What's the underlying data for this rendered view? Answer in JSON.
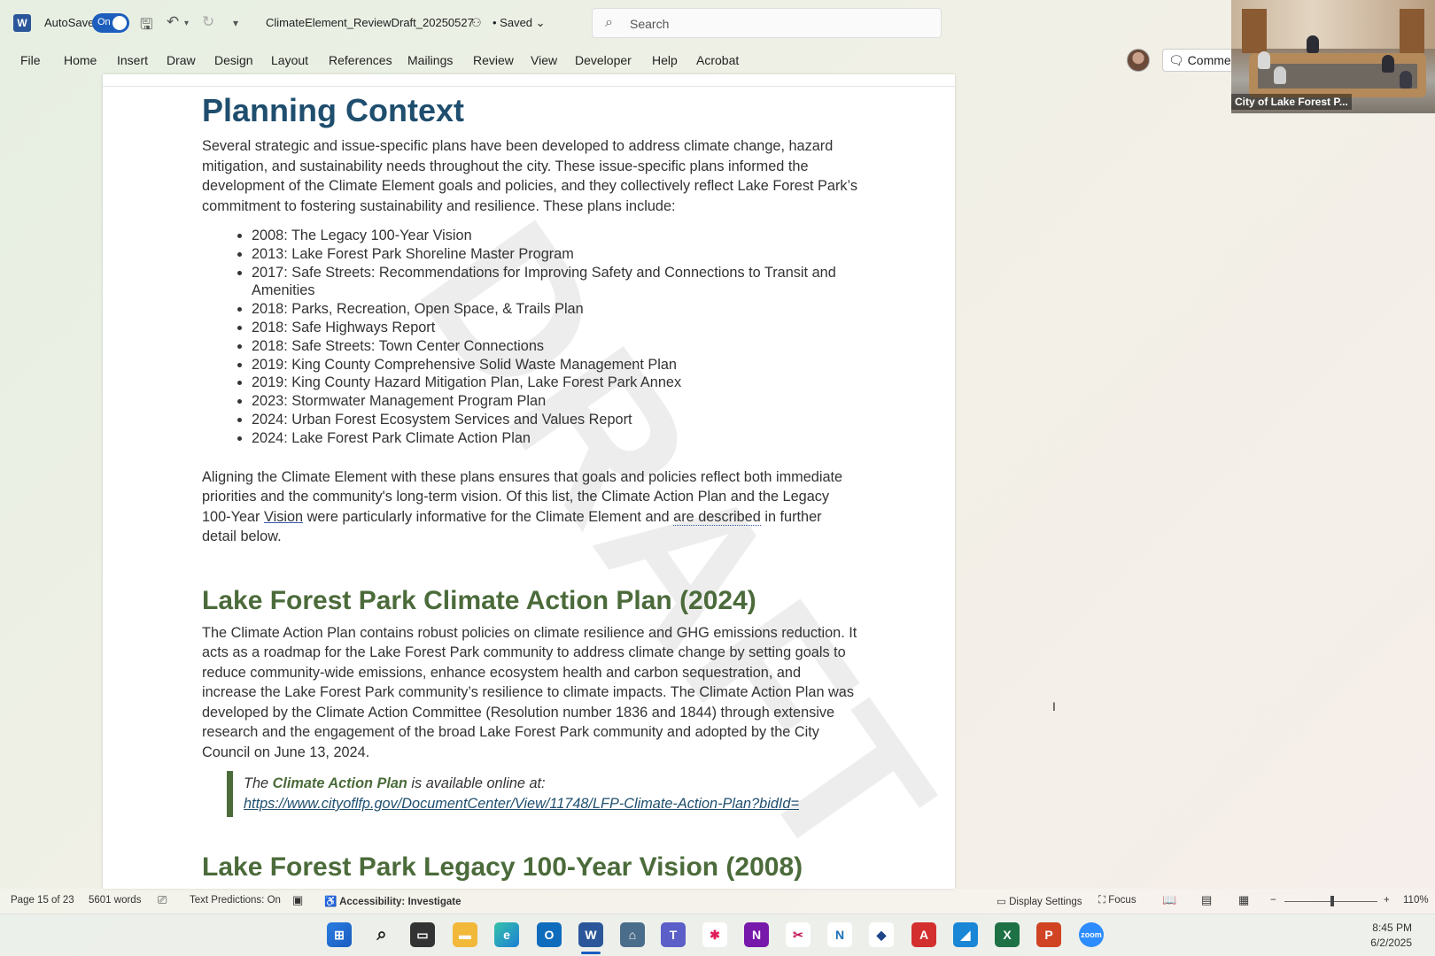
{
  "titlebar": {
    "app_icon": "W",
    "autosave_label": "AutoSave",
    "autosave_state": "On",
    "document_name": "ClimateElement_ReviewDraft_20250527",
    "saved_status": "• Saved",
    "search_placeholder": "Search"
  },
  "ribbon": {
    "tabs": [
      "File",
      "Home",
      "Insert",
      "Draw",
      "Design",
      "Layout",
      "References",
      "Mailings",
      "Review",
      "View",
      "Developer",
      "Help",
      "Acrobat"
    ],
    "comments_label": "Comments"
  },
  "video": {
    "participant_label": "City of Lake Forest P..."
  },
  "document": {
    "watermark": "DRAFT",
    "heading1": "Planning Context",
    "para1": "Several strategic and issue-specific plans have been developed to address climate change, hazard mitigation, and sustainability needs throughout the city. These issue-specific plans informed the development of the Climate Element goals and policies, and they collectively reflect Lake Forest Park’s commitment to fostering sustainability and resilience. These plans include:",
    "plans": [
      "2008: The Legacy 100-Year Vision",
      "2013: Lake Forest Park Shoreline Master Program",
      "2017: Safe Streets: Recommendations for Improving Safety and Connections to Transit and Amenities",
      "2018: Parks, Recreation, Open Space, & Trails Plan",
      "2018: Safe Highways Report",
      "2018: Safe Streets: Town Center Connections",
      "2019: King County Comprehensive Solid Waste Management Plan",
      "2019: King County Hazard Mitigation Plan, Lake Forest Park Annex",
      "2023: Stormwater Management Program Plan",
      "2024: Urban Forest Ecosystem Services and Values Report",
      "2024: Lake Forest Park Climate Action Plan"
    ],
    "para2_a": "Aligning the Climate Element with these plans ensures that goals and policies reflect both immediate priorities and the community's long-term vision. Of this list, the Climate Action Plan and the Legacy 100-Year ",
    "para2_vision": "Vision",
    "para2_b": " were particularly informative for the Climate Element and ",
    "para2_are": "are described",
    "para2_c": " in further detail below.",
    "heading2": "Lake Forest Park Climate Action Plan (2024)",
    "para3": "The Climate Action Plan contains robust policies on climate resilience and GHG emissions reduction. It acts as a roadmap for the Lake Forest Park community to address climate change by setting goals to reduce community-wide emissions, enhance ecosystem health and carbon sequestration, and increase the Lake Forest Park community’s resilience to climate impacts. The Climate Action Plan was developed by the Climate Action Committee (Resolution number 1836 and 1844) through extensive research and the engagement of the broad Lake Forest Park community and adopted by the City Council on June 13, 2024.",
    "callout_the": "The ",
    "callout_bold": "Climate Action Plan",
    "callout_rest": " is available online at:",
    "callout_link": "https://www.cityoflfp.gov/DocumentCenter/View/11748/LFP-Climate-Action-Plan?bidId=",
    "heading3_cut": "Lake Forest Park Legacy 100-Year Vision (2008)"
  },
  "statusbar": {
    "page": "Page 15 of 23",
    "words": "5601 words",
    "text_predictions": "Text Predictions: On",
    "accessibility": "Accessibility: Investigate",
    "display_settings": "Display Settings",
    "focus": "Focus",
    "zoom": "110%"
  },
  "taskbar": {
    "time": "8:45 PM",
    "date": "6/2/2025"
  }
}
